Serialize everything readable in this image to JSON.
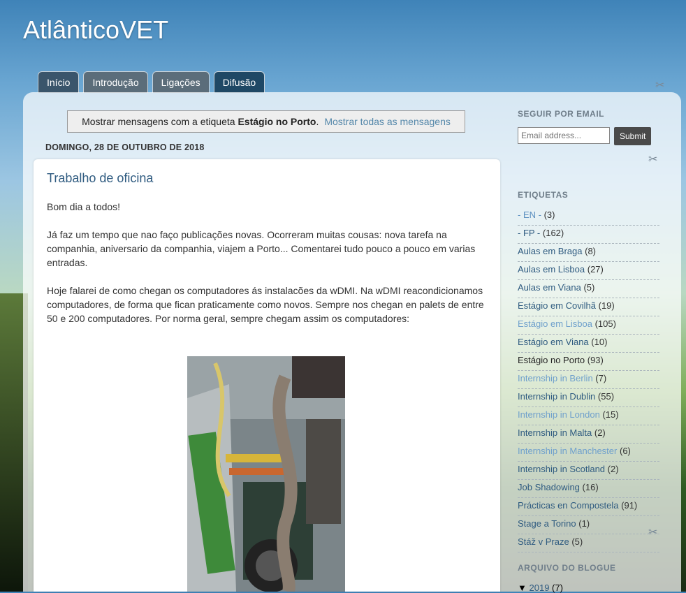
{
  "blog": {
    "title": "AtlânticoVET"
  },
  "tabs": [
    {
      "label": "Início"
    },
    {
      "label": "Introdução"
    },
    {
      "label": "Ligações"
    },
    {
      "label": "Difusão"
    }
  ],
  "status": {
    "prefix": "Mostrar mensagens com a etiqueta ",
    "label": "Estágio no Porto",
    "suffix": ".",
    "show_all": "Mostrar todas as mensagens"
  },
  "date_header": "DOMINGO, 28 DE OUTUBRO DE 2018",
  "post": {
    "title": "Trabalho de oficina",
    "paragraphs": [
      "Bom dia a todos!",
      "Já faz um tempo que nao faço publicações novas. Ocorreram muitas cousas: nova tarefa na companhia, aniversario da companhia, viajem a Porto... Comentarei tudo pouco a pouco em varias entradas.",
      "Hoje falarei de como chegan os computadores ás instalacões da wDMI. Na wDMI reacondicionamos computadores, de forma que fican praticamente como novos. Sempre nos chegan en palets de entre 50 e 200 computadores. Por norma geral, sempre chegam assim os computadores:"
    ]
  },
  "sidebar": {
    "follow_heading": "SEGUIR POR EMAIL",
    "email_placeholder": "Email address...",
    "submit_label": "Submit",
    "labels_heading": "ETIQUETAS",
    "labels": [
      {
        "name": "- EN -",
        "count": "(3)",
        "color": "#5b8fc0"
      },
      {
        "name": "- FP -",
        "count": "(162)",
        "color": "#2f5b80"
      },
      {
        "name": "Aulas em Braga",
        "count": "(8)",
        "color": "#2f5b80"
      },
      {
        "name": "Aulas em Lisboa",
        "count": "(27)",
        "color": "#2f5b80"
      },
      {
        "name": "Aulas em Viana",
        "count": "(5)",
        "color": "#2f5b80"
      },
      {
        "name": "Estágio em Covilhã",
        "count": "(19)",
        "color": "#2f5b80"
      },
      {
        "name": "Estágio em Lisboa",
        "count": "(105)",
        "color": "#6fa0cc"
      },
      {
        "name": "Estágio em Viana",
        "count": "(10)",
        "color": "#2f5b80"
      },
      {
        "name": "Estágio no Porto",
        "count": "(93)",
        "color": "#222222"
      },
      {
        "name": "Internship in Berlin",
        "count": "(7)",
        "color": "#6fa0cc"
      },
      {
        "name": "Internship in Dublin",
        "count": "(55)",
        "color": "#2f5b80"
      },
      {
        "name": "Internship in London",
        "count": "(15)",
        "color": "#6fa0cc"
      },
      {
        "name": "Internship in Malta",
        "count": "(2)",
        "color": "#2f5b80"
      },
      {
        "name": "Internship in Manchester",
        "count": "(6)",
        "color": "#6fa0cc"
      },
      {
        "name": "Internship in Scotland",
        "count": "(2)",
        "color": "#2f5b80"
      },
      {
        "name": "Job Shadowing",
        "count": "(16)",
        "color": "#2f5b80"
      },
      {
        "name": "Prácticas en Compostela",
        "count": "(91)",
        "color": "#2f5b80"
      },
      {
        "name": "Stage a Torino",
        "count": "(1)",
        "color": "#2f5b80"
      },
      {
        "name": "Stáž v Praze",
        "count": "(5)",
        "color": "#2f5b80"
      }
    ],
    "archive_heading": "ARQUIVO DO BLOGUE",
    "archive": {
      "toggle": "▼",
      "year": "2019",
      "count": "(7)"
    }
  },
  "icons": {
    "wrench": "wrench-icon"
  }
}
